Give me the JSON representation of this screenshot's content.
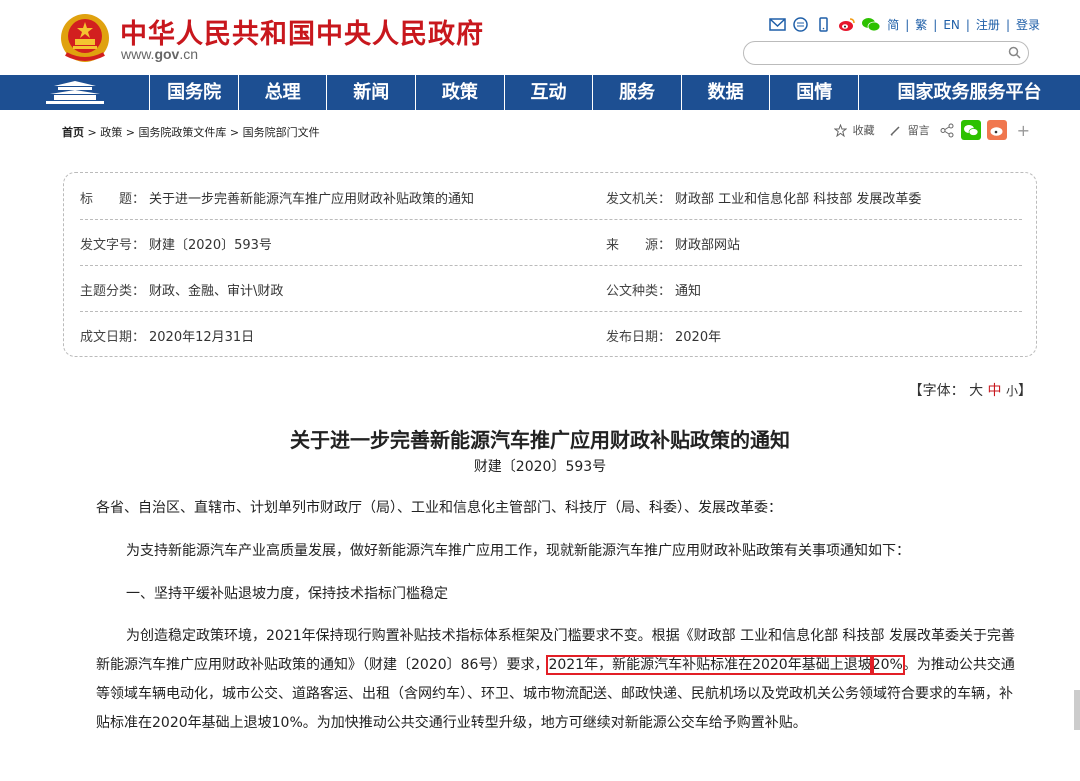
{
  "header": {
    "site_name": "中华人民共和国中央人民政府",
    "site_url_prefix": "www.",
    "site_url_bold": "gov",
    "site_url_suffix": ".cn",
    "tools": {
      "simplified": "简",
      "traditional": "繁",
      "english": "EN",
      "register": "注册",
      "login": "登录",
      "separator": "|"
    },
    "search_placeholder": ""
  },
  "nav": {
    "items": [
      "国务院",
      "总理",
      "新闻",
      "政策",
      "互动",
      "服务",
      "数据",
      "国情",
      "国家政务服务平台"
    ]
  },
  "breadcrumb": {
    "home": "首页",
    "sep": " > ",
    "items": [
      "政策",
      "国务院政策文件库",
      "国务院部门文件"
    ]
  },
  "share": {
    "favorite": "收藏",
    "comment": "留言",
    "more": "+"
  },
  "meta": {
    "title_key": "标　　题：",
    "title_val": "关于进一步完善新能源汽车推广应用财政补贴政策的通知",
    "issuer_key": "发文机关：",
    "issuer_val": "财政部 工业和信息化部 科技部 发展改革委",
    "docno_key": "发文字号：",
    "docno_val": "财建〔2020〕593号",
    "source_key": "来　　源：",
    "source_val": "财政部网站",
    "category_key": "主题分类：",
    "category_val": "财政、金融、审计\\财政",
    "type_key": "公文种类：",
    "type_val": "通知",
    "created_key": "成文日期：",
    "created_val": "2020年12月31日",
    "published_key": "发布日期：",
    "published_val": "2020年"
  },
  "fontsize": {
    "open": "【字体：",
    "large": "大",
    "medium": "中",
    "small": "小",
    "close": "】"
  },
  "article": {
    "title": "关于进一步完善新能源汽车推广应用财政补贴政策的通知",
    "docno": "财建〔2020〕593号",
    "p1": "各省、自治区、直辖市、计划单列市财政厅（局）、工业和信息化主管部门、科技厅（局、科委）、发展改革委：",
    "p2": "为支持新能源汽车产业高质量发展，做好新能源汽车推广应用工作，现就新能源汽车推广应用财政补贴政策有关事项通知如下：",
    "p3": "一、坚持平缓补贴退坡力度，保持技术指标门槛稳定",
    "p4_a": "为创造稳定政策环境，2021年保持现行购置补贴技术指标体系框架及门槛要求不变。根据《财政部 工业和信息化部 科技部 发展改革委关于完善新能源汽车推广应用财政补贴政策的通知》（财建〔2020〕86号）要求，",
    "p4_hl1": "2021年，新能源汽车补贴标准在2020年基础上退坡",
    "p4_hl2": "20%",
    "p4_b": "。为推动公共交通等领域车辆电动化，城市公交、道路客运、出租（含网约车）、环卫、城市物流配送、邮政快递、民航机场以及党政机关公务领域符合要求的车辆，补贴标准在2020年基础上退坡10%。为加快推动公共交通行业转型升级，地方可继续对新能源公交车给予购置补贴。"
  },
  "colors": {
    "brand_red": "#c8171d",
    "nav_blue": "#1d4f92",
    "link_blue": "#1f5fa8",
    "highlight_red": "#e21f26"
  }
}
